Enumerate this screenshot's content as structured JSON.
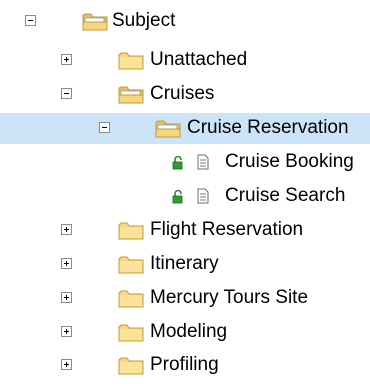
{
  "tree": {
    "root": {
      "label": "Subject",
      "icon": "folder-open-icon",
      "state": "expanded"
    },
    "items": [
      {
        "label": "Unattached",
        "icon": "folder-icon",
        "state": "collapsed"
      },
      {
        "label": "Cruises",
        "icon": "folder-open-icon",
        "state": "expanded"
      },
      {
        "label": "Cruise Reservation",
        "icon": "folder-open-icon",
        "state": "expanded",
        "selected": true
      },
      {
        "label": "Cruise Booking",
        "icon": "document-icon",
        "status_icon": "unlocked-icon"
      },
      {
        "label": "Cruise Search",
        "icon": "document-icon",
        "status_icon": "unlocked-icon"
      },
      {
        "label": "Flight Reservation",
        "icon": "folder-icon",
        "state": "collapsed"
      },
      {
        "label": "Itinerary",
        "icon": "folder-icon",
        "state": "collapsed"
      },
      {
        "label": "Mercury Tours Site",
        "icon": "folder-icon",
        "state": "collapsed"
      },
      {
        "label": "Modeling",
        "icon": "folder-icon",
        "state": "collapsed"
      },
      {
        "label": "Profiling",
        "icon": "folder-icon",
        "state": "collapsed"
      }
    ]
  },
  "colors": {
    "selection": "#cce4f7",
    "folder": "#f5d27a",
    "folder_edge": "#c99a2e",
    "lock": "#2e8b2e"
  }
}
